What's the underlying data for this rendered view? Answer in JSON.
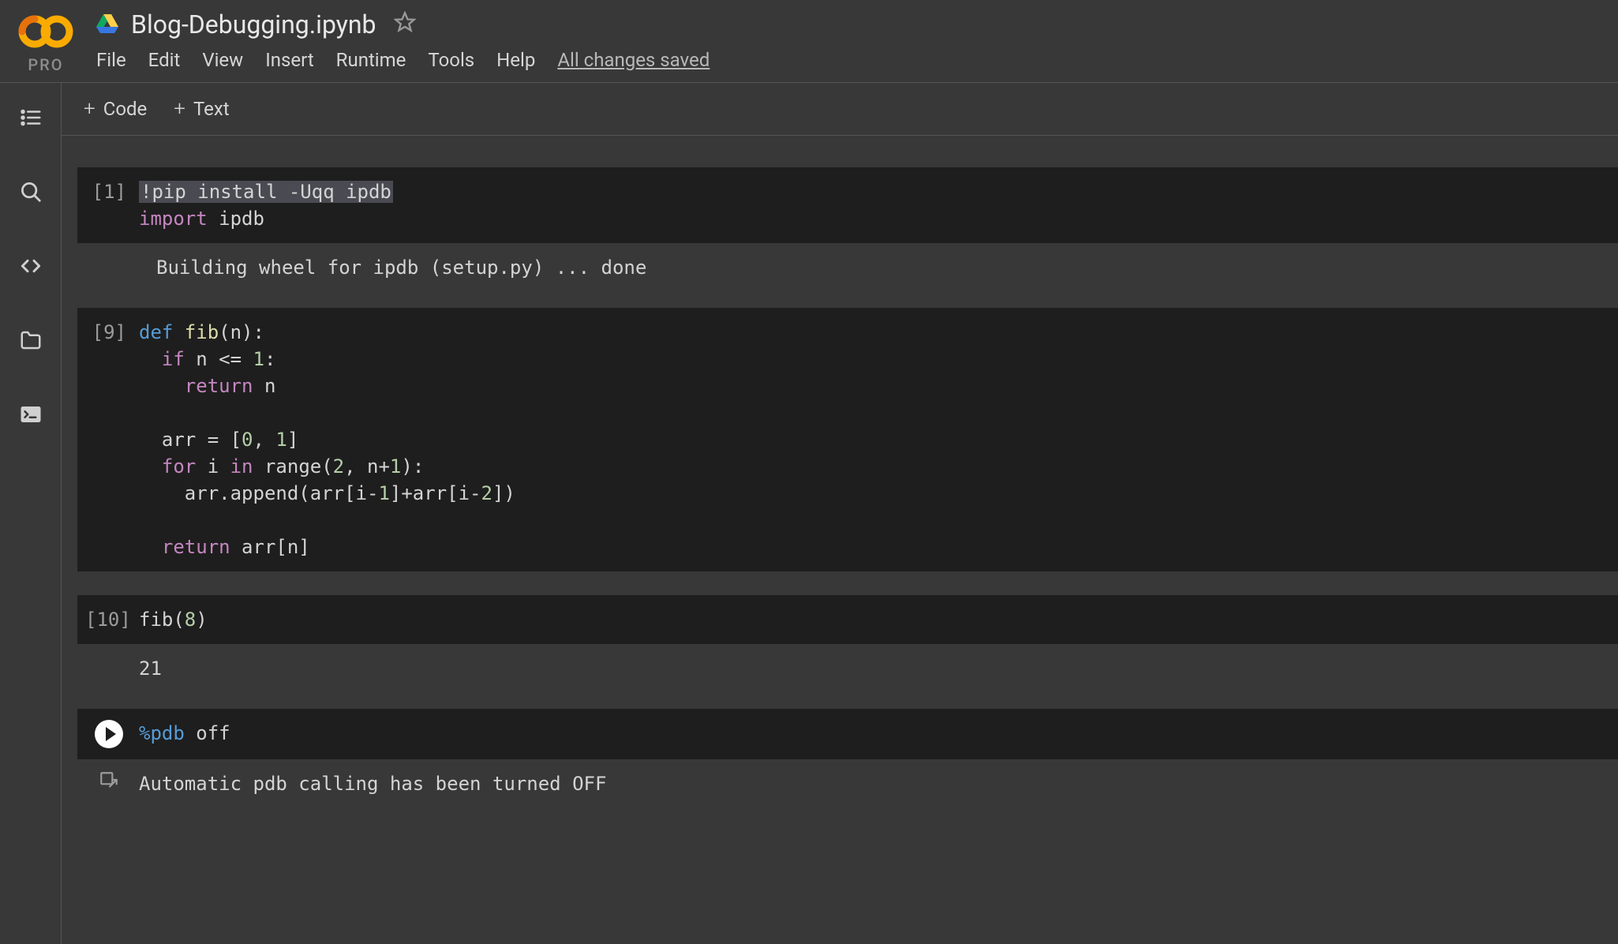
{
  "header": {
    "pro_label": "PRO",
    "filename": "Blog-Debugging.ipynb"
  },
  "menu": {
    "file": "File",
    "edit": "Edit",
    "view": "View",
    "insert": "Insert",
    "runtime": "Runtime",
    "tools": "Tools",
    "help": "Help",
    "saved_status": "All changes saved"
  },
  "toolbar": {
    "code_label": "Code",
    "text_label": "Text"
  },
  "cells": {
    "c1": {
      "exec": "[1]",
      "line1_cmd": "!pip install -Uqq ipdb",
      "line2_kw": "import",
      "line2_mod": " ipdb",
      "output": "Building wheel for ipdb (setup.py) ... done"
    },
    "c2": {
      "exec": "[9]",
      "l1_def": "def ",
      "l1_fn": "fib",
      "l1_rest": "(n):",
      "l2_if": "  if",
      "l2_rest": " n <= ",
      "l2_num": "1",
      "l2_colon": ":",
      "l3_ret": "    return",
      "l3_rest": " n",
      "l4": "",
      "l5_pre": "  arr = [",
      "l5_n1": "0",
      "l5_mid": ", ",
      "l5_n2": "1",
      "l5_post": "]",
      "l6_for": "  for",
      "l6_mid1": " i ",
      "l6_in": "in",
      "l6_mid2": " range(",
      "l6_n1": "2",
      "l6_mid3": ", n+",
      "l6_n2": "1",
      "l6_post": "):",
      "l7": "    arr.append(arr[i-",
      "l7_n1": "1",
      "l7_mid": "]+arr[i-",
      "l7_n2": "2",
      "l7_post": "])",
      "l8": "",
      "l9_ret": "  return",
      "l9_rest": " arr[n]"
    },
    "c3": {
      "exec": "[10]",
      "code": "fib(",
      "num": "8",
      "post": ")",
      "output": "21"
    },
    "c4": {
      "magic": "%pdb",
      "arg": " off",
      "output": "Automatic pdb calling has been turned OFF"
    }
  }
}
